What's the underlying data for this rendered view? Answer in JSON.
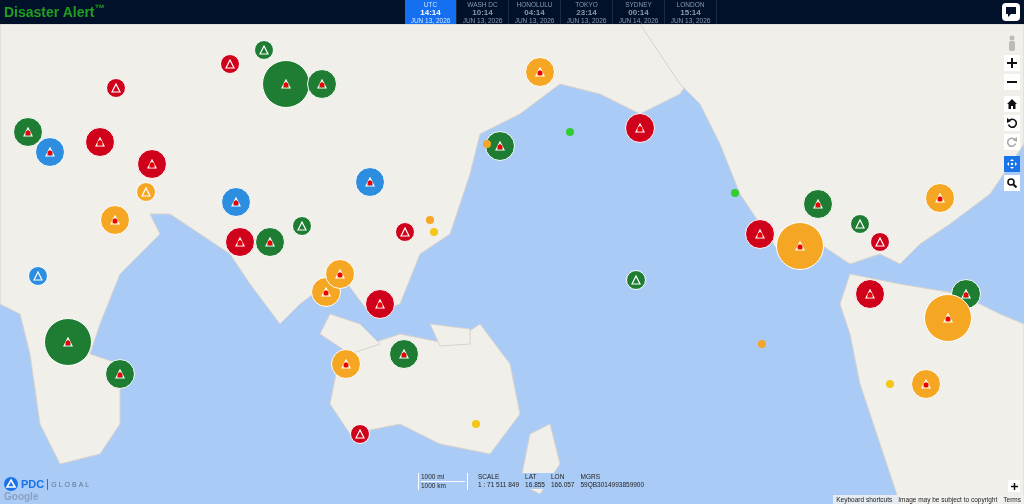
{
  "app": {
    "title": "Disaster Alert$^{™}$"
  },
  "clocks": [
    {
      "city": "UTC",
      "time": "14:14",
      "date": "JUN 13, 2026",
      "selected": true
    },
    {
      "city": "WASH DC",
      "time": "10:14",
      "date": "JUN 13, 2026",
      "selected": false
    },
    {
      "city": "HONOLULU",
      "time": "04:14",
      "date": "JUN 13, 2026",
      "selected": false
    },
    {
      "city": "TOKYO",
      "time": "23:14",
      "date": "JUN 13, 2026",
      "selected": false
    },
    {
      "city": "SYDNEY",
      "time": "00:14",
      "date": "JUN 14, 2026",
      "selected": false
    },
    {
      "city": "LONDON",
      "time": "15:14",
      "date": "JUN 13, 2026",
      "selected": false
    }
  ],
  "markers": [
    {
      "color": "#1e7d32",
      "kind": "cluster"
    },
    {
      "color": "#d0021b",
      "kind": "cluster"
    },
    {
      "color": "#f5a623",
      "kind": "cluster"
    },
    {
      "color": "#2d8ee0",
      "kind": "cluster"
    },
    {
      "color": "#1e7d32",
      "kind": "big"
    },
    {
      "color": "#1e7d32",
      "kind": "cluster"
    },
    {
      "color": "#d0021b",
      "kind": "single"
    },
    {
      "color": "#f5a623",
      "kind": "cluster"
    },
    {
      "color": "#1e7d32",
      "kind": "single"
    },
    {
      "color": "#d0021b",
      "kind": "cluster"
    },
    {
      "color": "#f5a623",
      "kind": "single"
    },
    {
      "color": "#2d8ee0",
      "kind": "cluster"
    },
    {
      "color": "#1e7d32",
      "kind": "cluster"
    },
    {
      "color": "#d0021b",
      "kind": "cluster"
    },
    {
      "color": "#f5a623",
      "kind": "cluster"
    },
    {
      "color": "#1e7d32",
      "kind": "single"
    },
    {
      "color": "#d0021b",
      "kind": "single"
    },
    {
      "color": "#2d8ee0",
      "kind": "cluster"
    },
    {
      "color": "#f5a623",
      "kind": "cluster"
    },
    {
      "color": "#1e7d32",
      "kind": "cluster"
    },
    {
      "color": "#d0021b",
      "kind": "cluster"
    },
    {
      "color": "#1e7d32",
      "kind": "big"
    },
    {
      "color": "#f5a623",
      "kind": "cluster"
    },
    {
      "color": "#2d8ee0",
      "kind": "single"
    },
    {
      "color": "#d0021b",
      "kind": "single"
    },
    {
      "color": "#1e7d32",
      "kind": "cluster"
    },
    {
      "color": "#d0021b",
      "kind": "cluster"
    },
    {
      "color": "#f5a623",
      "kind": "big"
    },
    {
      "color": "#1e7d32",
      "kind": "cluster"
    },
    {
      "color": "#d0021b",
      "kind": "single"
    },
    {
      "color": "#1e7d32",
      "kind": "single"
    },
    {
      "color": "#f5a623",
      "kind": "cluster"
    },
    {
      "color": "#d0021b",
      "kind": "cluster"
    },
    {
      "color": "#1e7d32",
      "kind": "cluster"
    },
    {
      "color": "#f5a623",
      "kind": "big"
    },
    {
      "color": "#d0021b",
      "kind": "single"
    },
    {
      "color": "#1e7d32",
      "kind": "cluster"
    },
    {
      "color": "#f5a623",
      "kind": "cluster"
    },
    {
      "color": "#d0021b",
      "kind": "cluster"
    },
    {
      "color": "#1e7d32",
      "kind": "single"
    },
    {
      "color": "#f5c518",
      "kind": "dot"
    },
    {
      "color": "#f5a623",
      "kind": "dot"
    },
    {
      "color": "#32cd32",
      "kind": "dot"
    },
    {
      "color": "#f5a623",
      "kind": "dot"
    },
    {
      "color": "#f5c518",
      "kind": "dot"
    },
    {
      "color": "#32cd32",
      "kind": "dot"
    },
    {
      "color": "#f5a623",
      "kind": "dot"
    },
    {
      "color": "#f5c518",
      "kind": "dot"
    }
  ],
  "map_info": {
    "scale_mi": "1000 mi",
    "scale_km": "1000 km",
    "labels": [
      "SCALE",
      "LAT",
      "LON",
      "MGRS"
    ],
    "values": [
      "1 : 71 511 849",
      "16.855",
      "166.057",
      "59QB3014993859900"
    ]
  },
  "logo": {
    "name": "PDC",
    "suffix": "GLOBAL"
  },
  "google": "Google",
  "attribution": [
    "Keyboard shortcuts",
    "Image may be subject to copyright",
    "Terms"
  ]
}
